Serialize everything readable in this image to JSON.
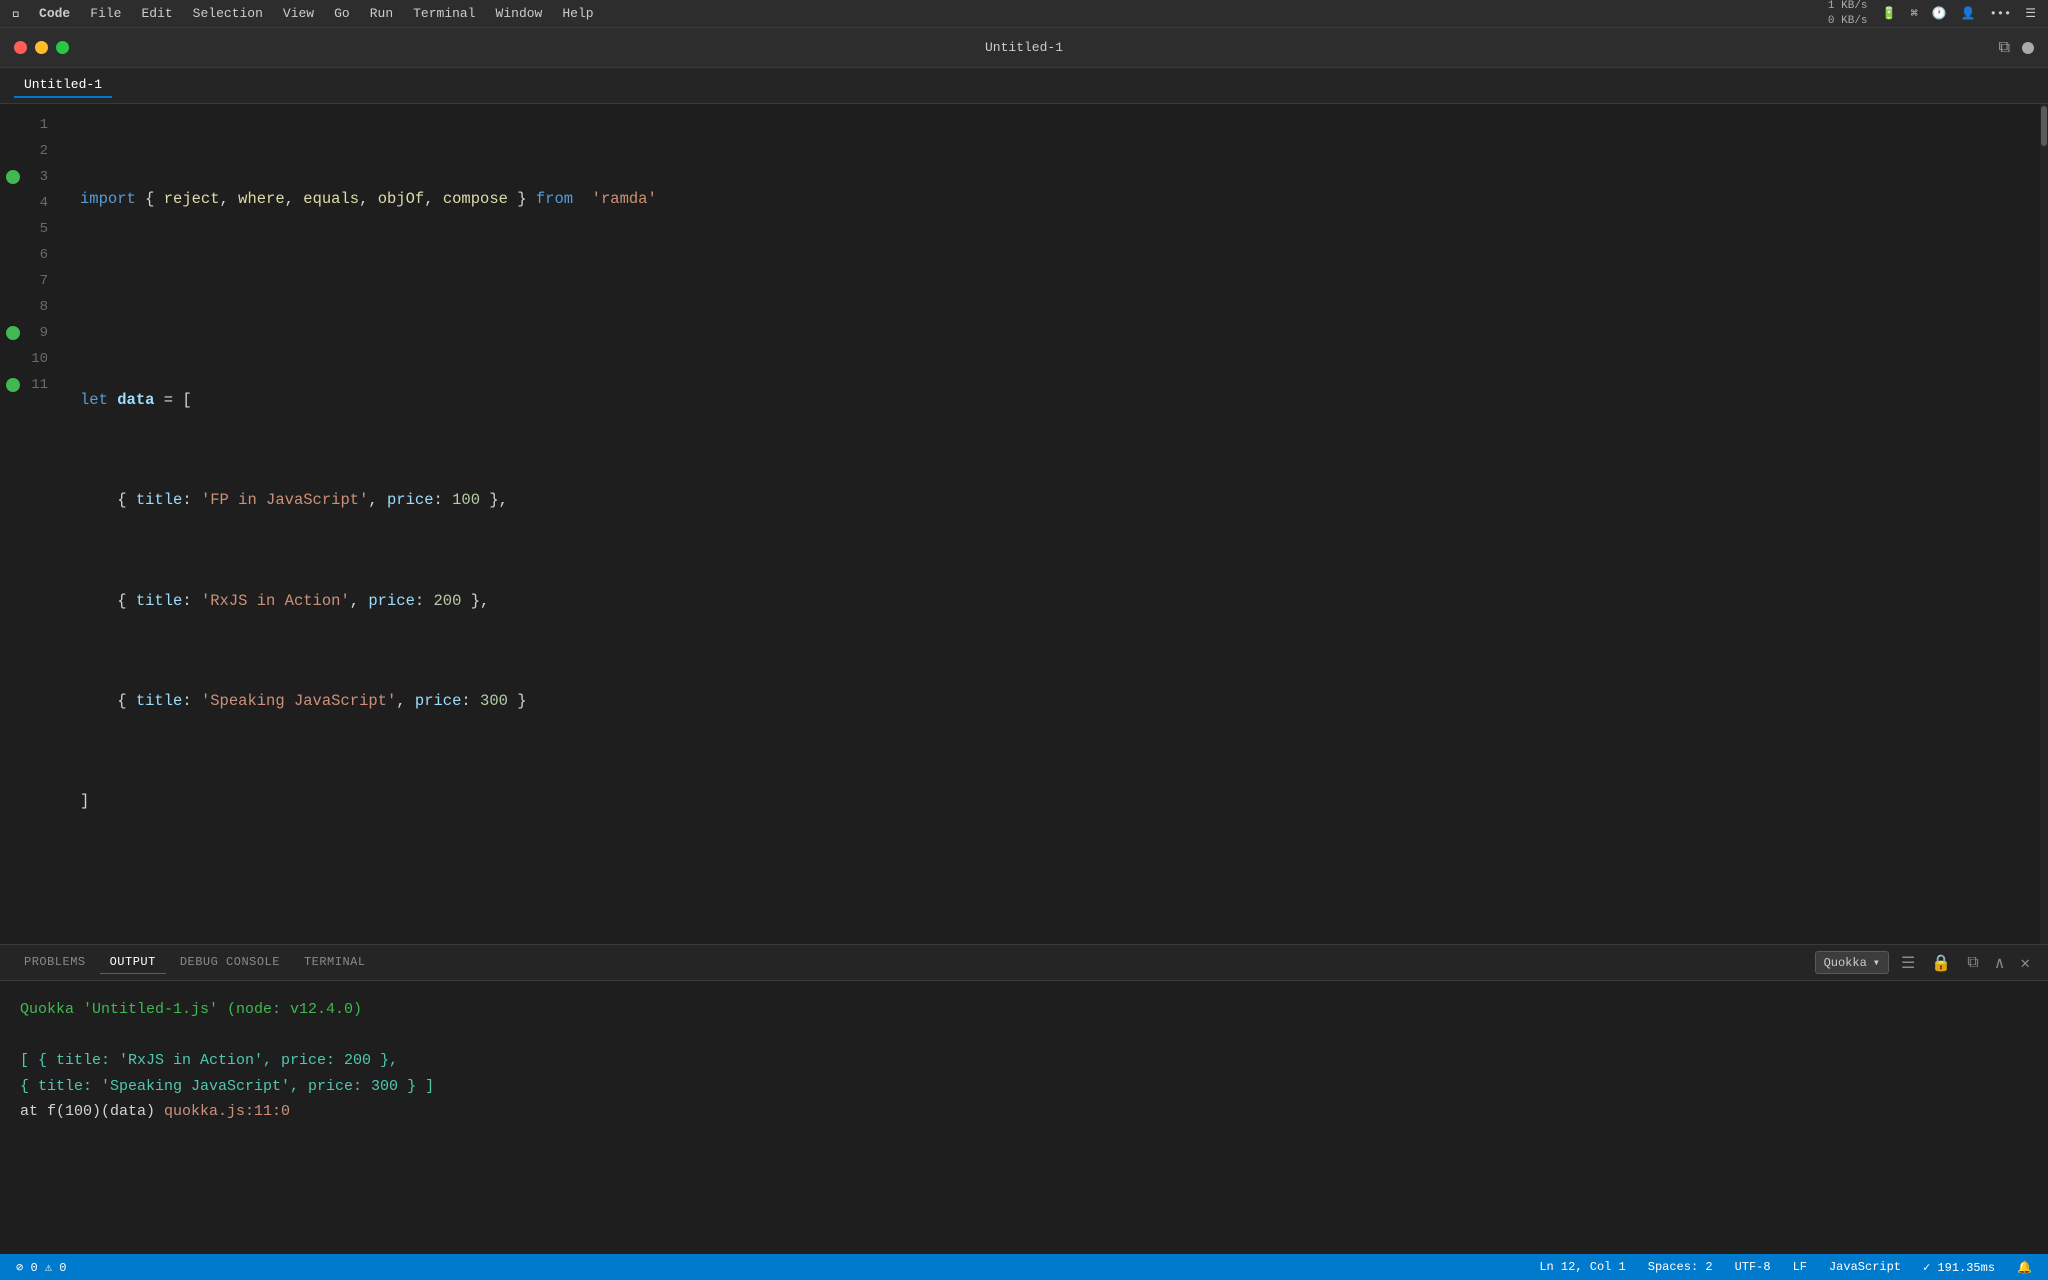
{
  "menubar": {
    "apple": "⌘",
    "items": [
      "Code",
      "File",
      "Edit",
      "Selection",
      "View",
      "Go",
      "Run",
      "Terminal",
      "Window",
      "Help"
    ],
    "status_kb": "1 KB/s",
    "status_kb2": "0 KB/s"
  },
  "titlebar": {
    "title": "Untitled-1"
  },
  "editor_tab": {
    "label": "Untitled-1"
  },
  "code": {
    "lines": [
      {
        "num": 1,
        "breakpoint": false,
        "content": "import_line"
      },
      {
        "num": 2,
        "breakpoint": false,
        "content": "empty"
      },
      {
        "num": 3,
        "breakpoint": true,
        "content": "let_data"
      },
      {
        "num": 4,
        "breakpoint": false,
        "content": "item1"
      },
      {
        "num": 5,
        "breakpoint": false,
        "content": "item2"
      },
      {
        "num": 6,
        "breakpoint": false,
        "content": "item3"
      },
      {
        "num": 7,
        "breakpoint": false,
        "content": "close_array"
      },
      {
        "num": 8,
        "breakpoint": false,
        "content": "empty"
      },
      {
        "num": 9,
        "breakpoint": true,
        "content": "let_f"
      },
      {
        "num": 10,
        "breakpoint": false,
        "content": "empty"
      },
      {
        "num": 11,
        "breakpoint": true,
        "content": "call_f"
      }
    ]
  },
  "panel": {
    "tabs": [
      {
        "label": "PROBLEMS",
        "active": false
      },
      {
        "label": "OUTPUT",
        "active": true
      },
      {
        "label": "DEBUG CONSOLE",
        "active": false
      },
      {
        "label": "TERMINAL",
        "active": false
      }
    ],
    "dropdown_label": "Quokka",
    "output_line1": "Quokka 'Untitled-1.js' (node: v12.4.0)",
    "output_line2": "",
    "output_line3": "[ { title: 'RxJS in Action', price: 200 },",
    "output_line4": "  { title: 'Speaking JavaScript', price: 300 } ]",
    "output_line5": "  at f(100)(data) quokka.js:11:0"
  },
  "statusbar": {
    "errors": "0",
    "warnings": "0",
    "ln": "Ln 12, Col 1",
    "spaces": "Spaces: 2",
    "encoding": "UTF-8",
    "eol": "LF",
    "language": "JavaScript",
    "timing": "✓ 191.35ms"
  }
}
